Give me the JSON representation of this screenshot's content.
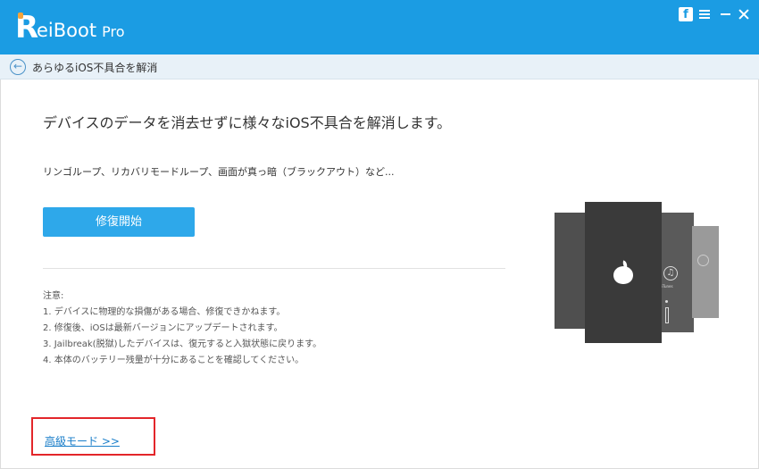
{
  "app": {
    "logo_letter": "R",
    "name": "eiBoot",
    "edition": "Pro"
  },
  "window_controls": {
    "facebook_label": "f"
  },
  "subbar": {
    "title": "あらゆるiOS不具合を解消"
  },
  "main": {
    "heading": "デバイスのデータを消去せずに様々なiOS不具合を解消します。",
    "description": "リンゴループ、リカバリモードループ、画面が真っ暗（ブラックアウト）など...",
    "repair_button": "修復開始",
    "notes_title": "注意:",
    "notes": [
      "1. デバイスに物理的な損傷がある場合、修復できかねます。",
      "2. 修復後、iOSは最新バージョンにアップデートされます。",
      "3. Jailbreak(脱獄)したデバイスは、復元すると入獄状態に戻ります。",
      "4. 本体のバッテリー残量が十分にあることを確認してください。"
    ],
    "advanced_mode": "高級モード >>"
  },
  "illustration": {
    "itunes_caption": "iTunes"
  }
}
